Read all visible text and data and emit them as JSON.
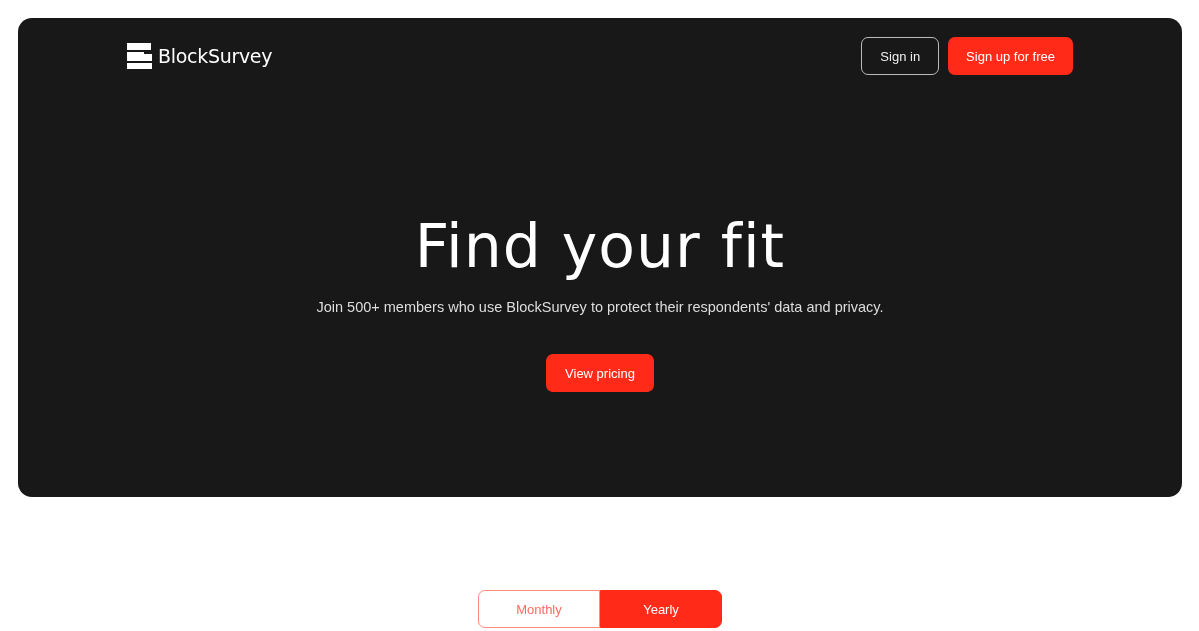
{
  "header": {
    "logo_text": "BlockSurvey",
    "buttons": [
      {
        "label": "Sign in",
        "kind": "outline"
      },
      {
        "label": "Sign up for free",
        "kind": "primary"
      }
    ]
  },
  "hero": {
    "title": "Find your fit",
    "subtitle": "Join 500+ members who use BlockSurvey to protect their respondents' data and privacy.",
    "button": "View pricing"
  },
  "billing_toggle": [
    {
      "label": "Monthly",
      "selected": false
    },
    {
      "label": "Yearly",
      "selected": true
    }
  ]
}
